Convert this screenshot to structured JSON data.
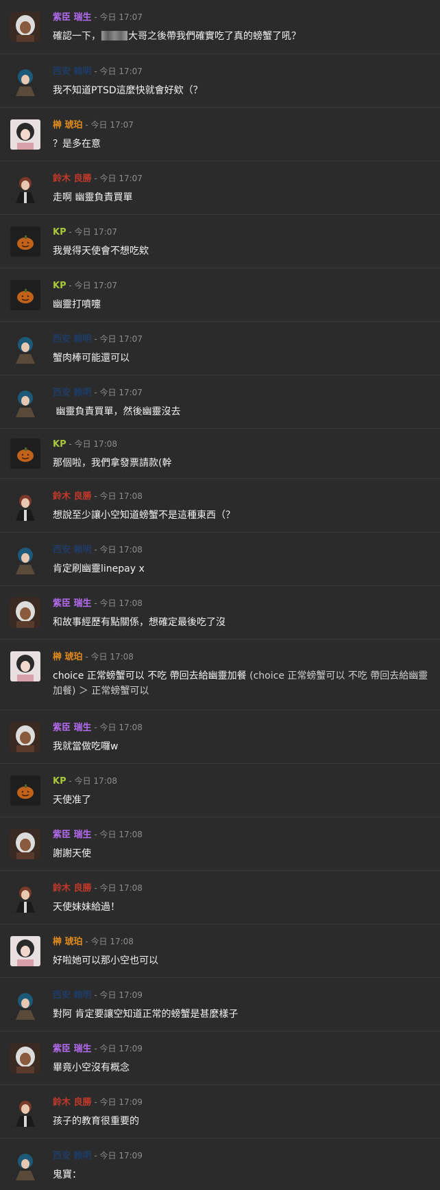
{
  "speakers": {
    "shion": {
      "name": "紫臣 瑞生",
      "color": "#b36bf0"
    },
    "nishiyasu": {
      "name": "西安 賴明",
      "color": "#1f3c66"
    },
    "sakaki": {
      "name": "榊 琥珀",
      "color": "#e08a1e"
    },
    "suzuki": {
      "name": "鈴木 良勝",
      "color": "#c0392b"
    },
    "kp": {
      "name": "KP",
      "color": "#a8c73b"
    }
  },
  "separator": " - ",
  "messages": [
    {
      "speaker": "紫臣 瑞生",
      "who": "shion",
      "time": "今日 17:07",
      "pre": "確認一下，",
      "post": "大哥之後帶我們確實吃了真的螃蟹了吼？"
    },
    {
      "speaker": "西安 賴明",
      "who": "nishiyasu",
      "time": "今日 17:07",
      "text": "我不知道PTSD這麼快就會好欸（？"
    },
    {
      "speaker": "榊 琥珀",
      "who": "sakaki",
      "time": "今日 17:07",
      "text": "？是多在意"
    },
    {
      "speaker": "鈴木 良勝",
      "who": "suzuki",
      "time": "今日 17:07",
      "text": "走啊 幽靈負責買單"
    },
    {
      "speaker": "KP",
      "who": "kp",
      "time": "今日 17:07",
      "text": "我覺得天使會不想吃欸"
    },
    {
      "speaker": "KP",
      "who": "kp",
      "time": "今日 17:07",
      "text": "幽靈打噴嚏"
    },
    {
      "speaker": "西安 賴明",
      "who": "nishiyasu",
      "time": "今日 17:07",
      "text": "蟹肉棒可能還可以"
    },
    {
      "speaker": "西安 賴明",
      "who": "nishiyasu",
      "time": "今日 17:07",
      "text": " 幽靈負責買單，然後幽靈沒去"
    },
    {
      "speaker": "KP",
      "who": "kp",
      "time": "今日 17:08",
      "text": "那個啦，我們拿發票請款(幹"
    },
    {
      "speaker": "鈴木 良勝",
      "who": "suzuki",
      "time": "今日 17:08",
      "text": "想說至少讓小空知道螃蟹不是這種東西（？"
    },
    {
      "speaker": "西安 賴明",
      "who": "nishiyasu",
      "time": "今日 17:08",
      "text": "肯定刷幽靈linepay x"
    },
    {
      "speaker": "紫臣 瑞生",
      "who": "shion",
      "time": "今日 17:08",
      "text": "和故事經歷有點關係，想確定最後吃了沒"
    },
    {
      "speaker": "榊 琥珀",
      "who": "sakaki",
      "time": "今日 17:08",
      "choice": "choice 正常螃蟹可以 不吃 帶回去給幽靈加餐",
      "echo": "(choice 正常螃蟹可以 不吃 帶回去給幽靈加餐) ＞ 正常螃蟹可以"
    },
    {
      "speaker": "紫臣 瑞生",
      "who": "shion",
      "time": "今日 17:08",
      "text": "我就當做吃囉w"
    },
    {
      "speaker": "KP",
      "who": "kp",
      "time": "今日 17:08",
      "text": "天使准了"
    },
    {
      "speaker": "紫臣 瑞生",
      "who": "shion",
      "time": "今日 17:08",
      "text": "謝謝天使"
    },
    {
      "speaker": "鈴木 良勝",
      "who": "suzuki",
      "time": "今日 17:08",
      "text": "天使妹妹給過！"
    },
    {
      "speaker": "榊 琥珀",
      "who": "sakaki",
      "time": "今日 17:08",
      "text": "好啦她可以那小空也可以"
    },
    {
      "speaker": "西安 賴明",
      "who": "nishiyasu",
      "time": "今日 17:09",
      "text": "對阿 肯定要讓空知道正常的螃蟹是甚麼樣子"
    },
    {
      "speaker": "紫臣 瑞生",
      "who": "shion",
      "time": "今日 17:09",
      "text": "畢竟小空沒有概念"
    },
    {
      "speaker": "鈴木 良勝",
      "who": "suzuki",
      "time": "今日 17:09",
      "text": "孩子的教育很重要的"
    },
    {
      "speaker": "西安 賴明",
      "who": "nishiyasu",
      "time": "今日 17:09",
      "text": "鬼寶："
    }
  ]
}
